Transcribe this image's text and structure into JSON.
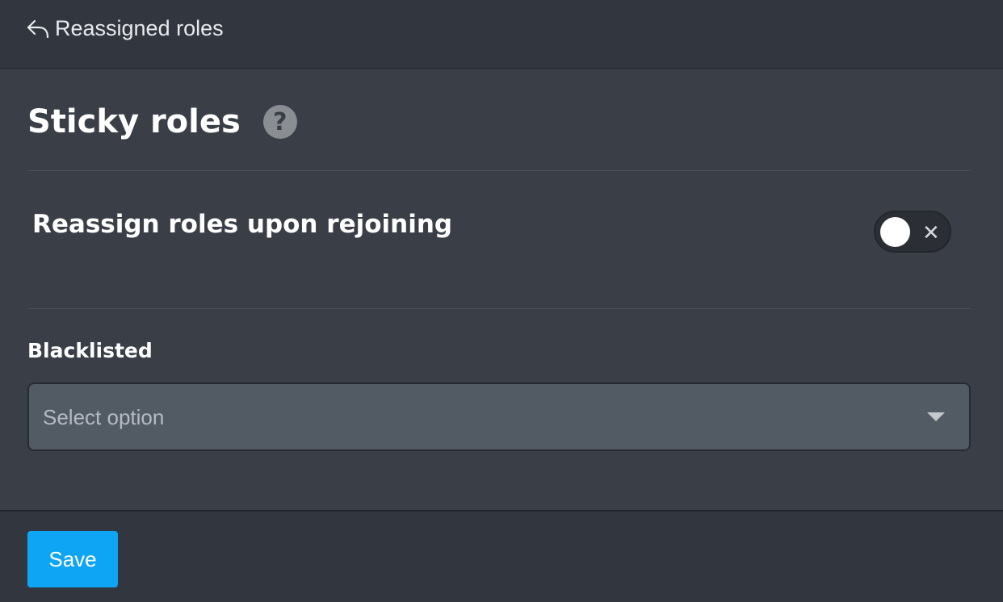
{
  "header": {
    "back_label": "Reassigned roles",
    "back_icon": "reply-arrow-icon"
  },
  "main": {
    "title": "Sticky roles",
    "help_icon": "question-circle-icon",
    "help_glyph": "?",
    "settings": [
      {
        "label": "Reassign roles upon rejoining",
        "toggle_enabled": false,
        "toggle_off_glyph": "✕"
      }
    ],
    "blacklisted": {
      "label": "Blacklisted",
      "placeholder": "Select option",
      "icon": "chevron-down-icon"
    }
  },
  "footer": {
    "save_label": "Save"
  },
  "colors": {
    "accent": "#0ea5f5",
    "background": "#32373f",
    "panel": "#3a3f47",
    "select_bg": "#525a64"
  }
}
